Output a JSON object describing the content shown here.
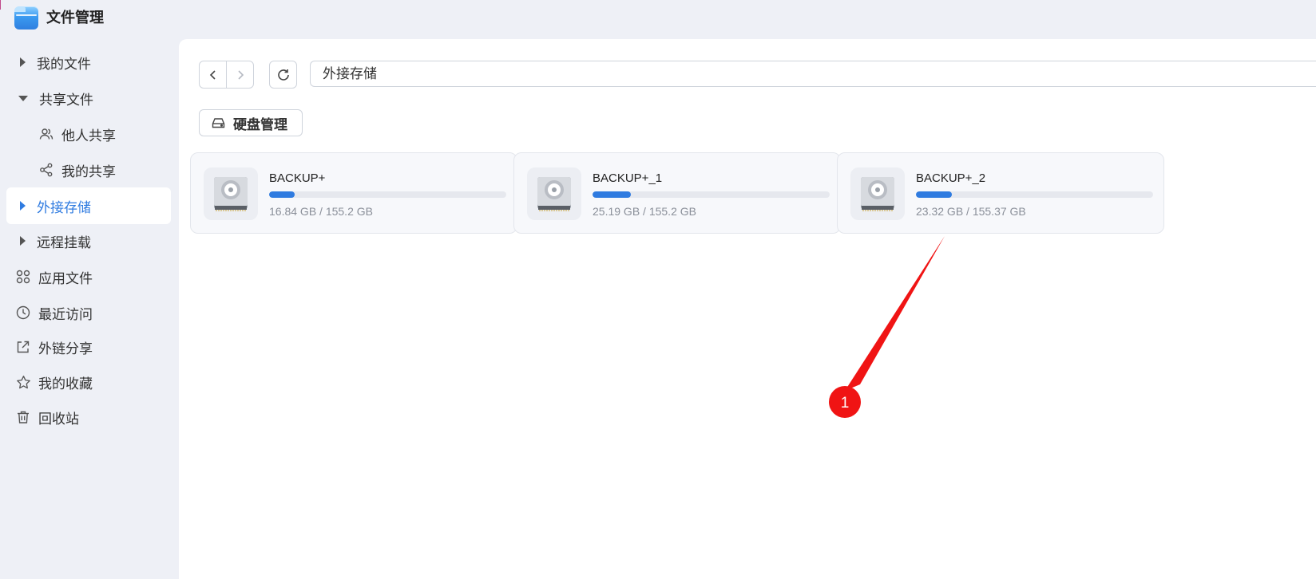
{
  "app": {
    "title": "文件管理"
  },
  "sidebar": {
    "items": [
      {
        "label": "我的文件",
        "icon": "caret-right-icon"
      },
      {
        "label": "共享文件",
        "icon": "caret-down-icon"
      },
      {
        "label": "他人共享",
        "icon": "users-icon"
      },
      {
        "label": "我的共享",
        "icon": "share-icon"
      },
      {
        "label": "外接存储",
        "icon": "caret-right-icon",
        "active": true
      },
      {
        "label": "远程挂载",
        "icon": "caret-right-icon"
      },
      {
        "label": "应用文件",
        "icon": "apps-icon"
      },
      {
        "label": "最近访问",
        "icon": "clock-icon"
      },
      {
        "label": "外链分享",
        "icon": "external-share-icon"
      },
      {
        "label": "我的收藏",
        "icon": "star-icon"
      },
      {
        "label": "回收站",
        "icon": "trash-icon"
      }
    ]
  },
  "toolbar": {
    "path": "外接存储",
    "disk_management_label": "硬盘管理"
  },
  "drives": [
    {
      "name": "BACKUP+",
      "usage": "16.84 GB / 155.2 GB",
      "used_fraction": 0.1085
    },
    {
      "name": "BACKUP+_1",
      "usage": "25.19 GB / 155.2 GB",
      "used_fraction": 0.1623
    },
    {
      "name": "BACKUP+_2",
      "usage": "23.32 GB / 155.37 GB",
      "used_fraction": 0.1501
    }
  ],
  "annotation": {
    "number": "1"
  },
  "colors": {
    "accent": "#2f7be0",
    "annotation": "#f01414",
    "sidebar_bg": "#eef0f6"
  }
}
